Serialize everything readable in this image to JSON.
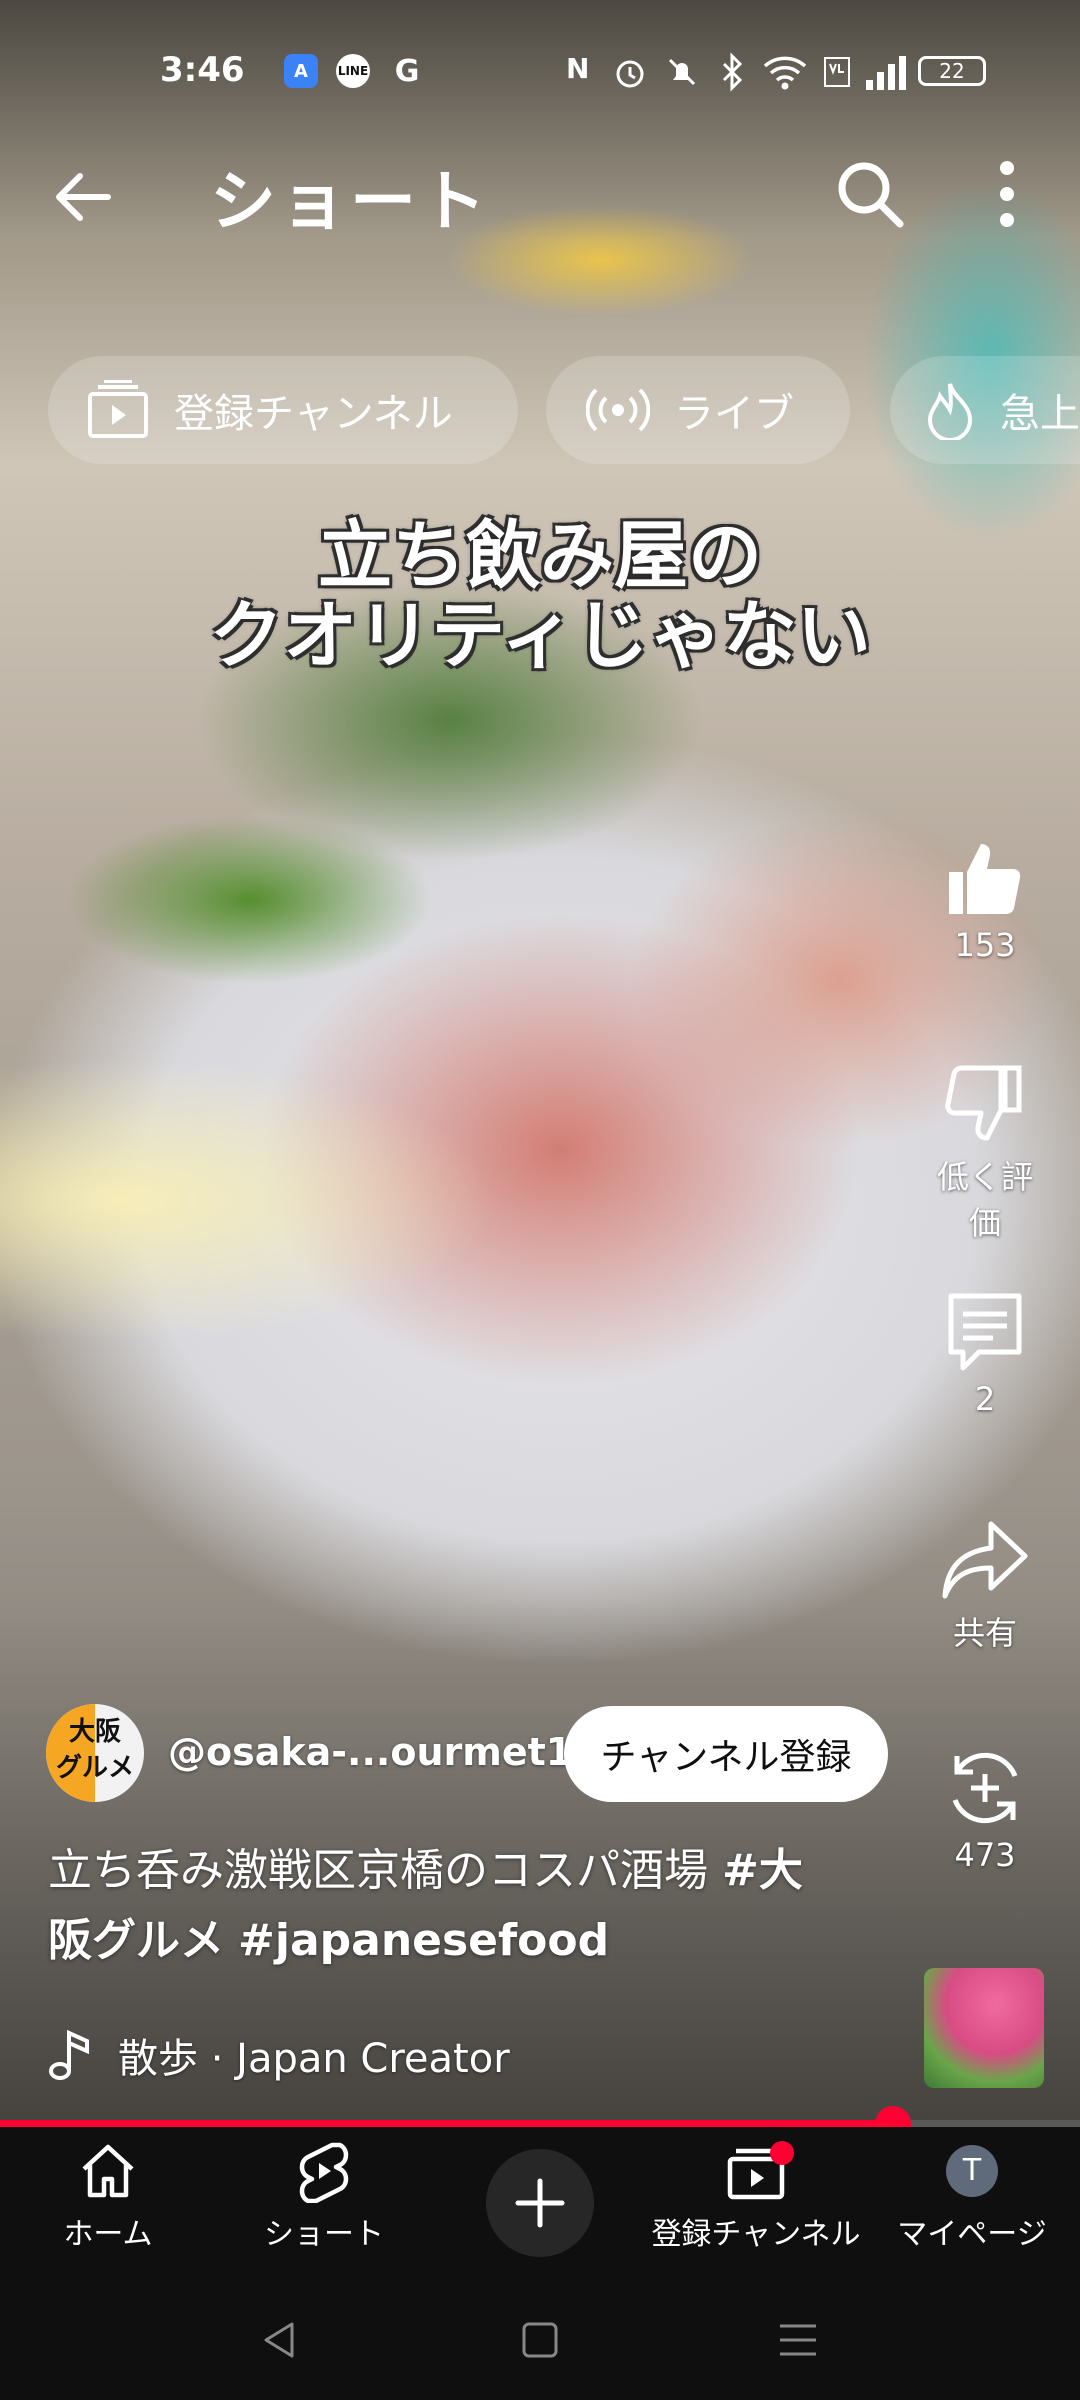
{
  "status_bar": {
    "time": "3:46",
    "app_a_label": "A",
    "app_line_label": "LINE",
    "app_g_label": "G",
    "nfc": "N",
    "battery": "22"
  },
  "header": {
    "title": "ショート"
  },
  "chips": [
    {
      "label": "登録チャンネル"
    },
    {
      "label": "ライブ"
    },
    {
      "label": "急上"
    }
  ],
  "video": {
    "caption_line1": "立ち飲み屋の",
    "caption_line2": "クオリティじゃない"
  },
  "actions": {
    "like_count": "153",
    "dislike_label": "低く評価",
    "comment_count": "2",
    "share_label": "共有",
    "remix_count": "473"
  },
  "channel": {
    "avatar_line1": "大阪",
    "avatar_line2": "グルメ",
    "handle": "@osaka-...ourmet1",
    "subscribe_label": "チャンネル登録"
  },
  "description": {
    "text_line1": "立ち呑み激戦区京橋のコスパ酒場 ",
    "hashtag1_line1": "#大",
    "hashtag1_line2": "阪グルメ",
    "hashtag2": "#japanesefood"
  },
  "music": {
    "label": "散歩 · Japan Creator"
  },
  "playback": {
    "progress_fraction": 0.827
  },
  "bottom_nav": {
    "home": "ホーム",
    "shorts": "ショート",
    "subscriptions": "登録チャンネル",
    "me": "マイページ",
    "me_initial": "T"
  },
  "colors": {
    "accent": "#ff0033",
    "nav_bg": "#0f0f0f"
  }
}
